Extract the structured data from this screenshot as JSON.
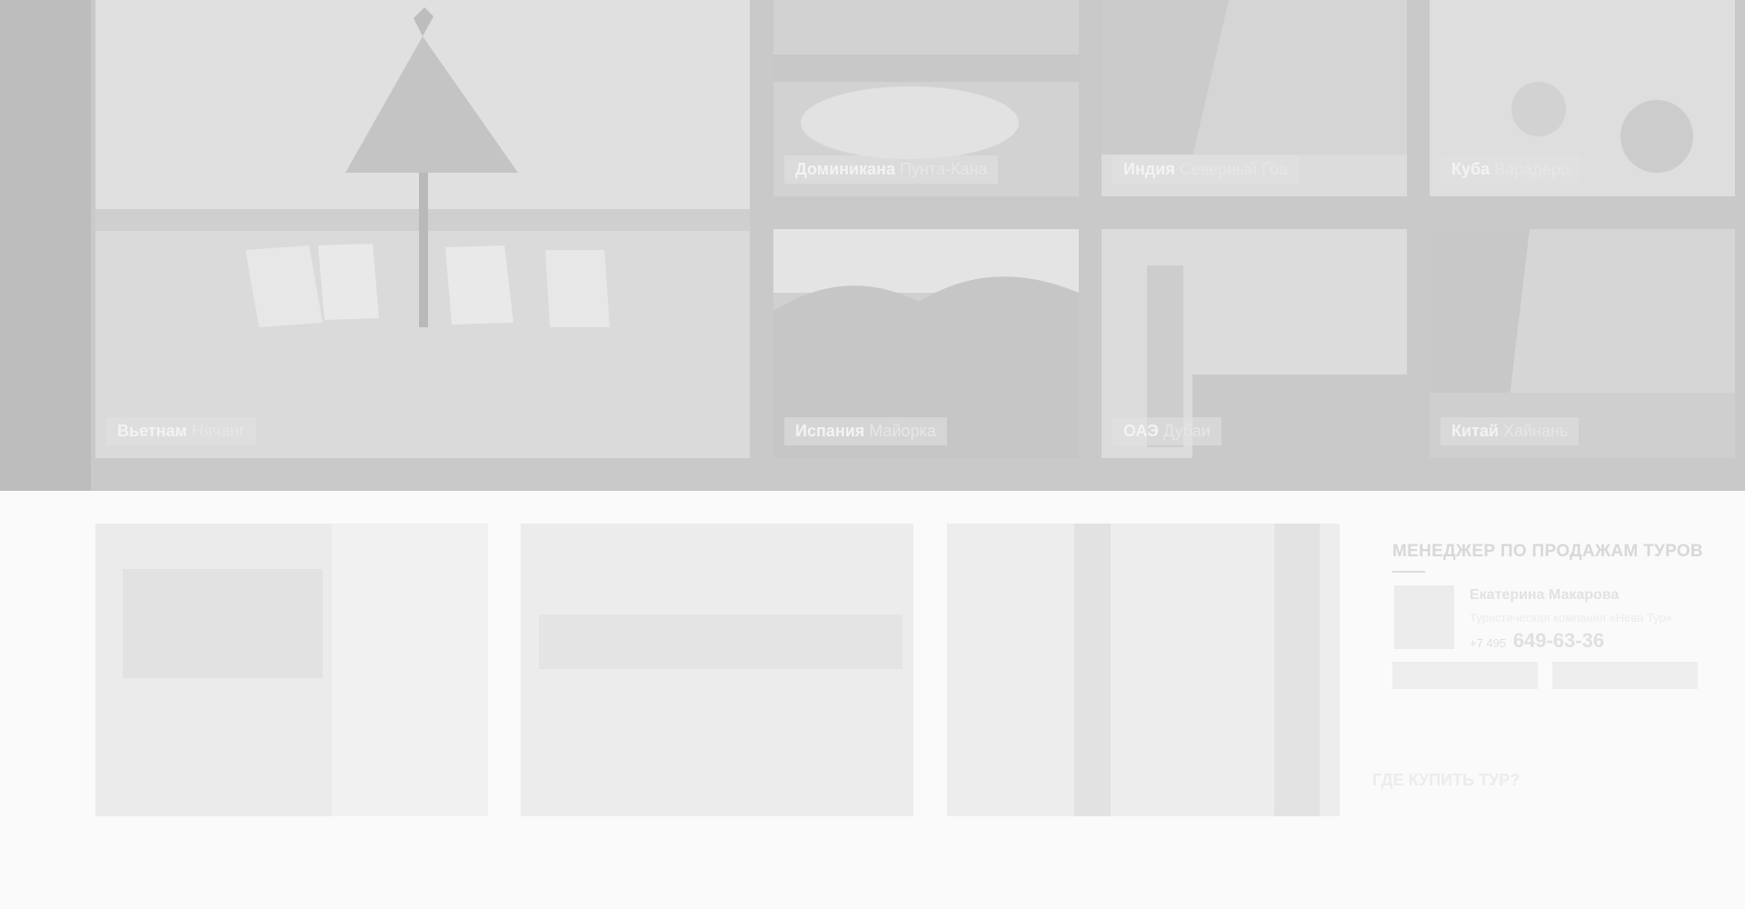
{
  "gallery": {
    "big": {
      "country": "Вьетнам",
      "resort": "Нячанг"
    },
    "tiles": [
      {
        "country": "Доминикана",
        "resort": "Пунта-Кана"
      },
      {
        "country": "Индия",
        "resort": "Северный Гоа"
      },
      {
        "country": "Куба",
        "resort": "Варадеро"
      },
      {
        "country": "Испания",
        "resort": "Майорка"
      },
      {
        "country": "ОАЭ",
        "resort": "Дубаи"
      },
      {
        "country": "Китай",
        "resort": "Хайнань"
      }
    ]
  },
  "cards": [
    {
      "title_line1": "",
      "title_line2": ""
    },
    {
      "title_line1": "",
      "title_line2": ""
    },
    {
      "title_line1": "",
      "title_line2": ""
    }
  ],
  "manager": {
    "heading": "МЕНЕДЖЕР ПО ПРОДАЖАМ ТУРОВ",
    "name": "Екатерина Макарова",
    "company": "Туристическая компания «Нева Тур»",
    "phone_prefix": "+7 495",
    "phone_number": "649-63-36",
    "button_call": "",
    "button_write": ""
  },
  "where_to_buy": {
    "heading": "ГДЕ КУПИТЬ ТУР?",
    "subtext": "",
    "right_text": ""
  }
}
